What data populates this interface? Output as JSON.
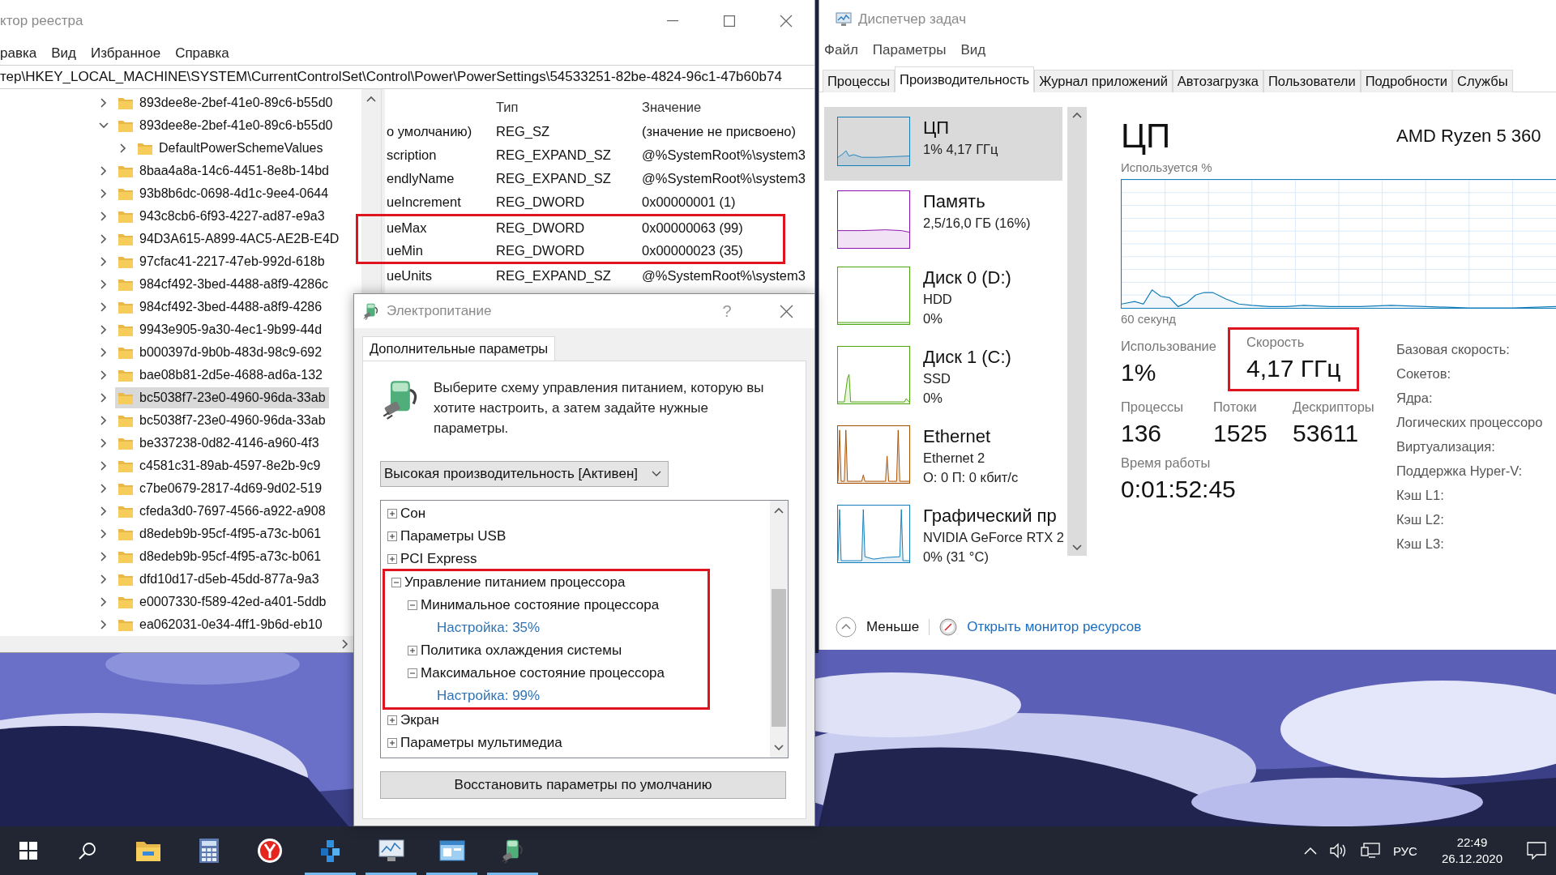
{
  "registry_editor": {
    "title": "ктор реестра",
    "menu": [
      "равка",
      "Вид",
      "Избранное",
      "Справка"
    ],
    "address": "тер\\HKEY_LOCAL_MACHINE\\SYSTEM\\CurrentControlSet\\Control\\Power\\PowerSettings\\54533251-82be-4824-96c1-47b60b74",
    "tree": [
      {
        "name": "893dee8e-2bef-41e0-89c6-b55d0",
        "expanded": false,
        "selected": false
      },
      {
        "name": "893dee8e-2bef-41e0-89c6-b55d0",
        "expanded": true,
        "selected": false,
        "children": [
          {
            "name": "DefaultPowerSchemeValues",
            "expanded": false,
            "selected": false
          }
        ]
      },
      {
        "name": "8baa4a8a-14c6-4451-8e8b-14bd",
        "expanded": false,
        "selected": false
      },
      {
        "name": "93b8b6dc-0698-4d1c-9ee4-0644",
        "expanded": false,
        "selected": false
      },
      {
        "name": "943c8cb6-6f93-4227-ad87-e9a3",
        "expanded": false,
        "selected": false
      },
      {
        "name": "94D3A615-A899-4AC5-AE2B-E4D",
        "expanded": false,
        "selected": false
      },
      {
        "name": "97cfac41-2217-47eb-992d-618b",
        "expanded": false,
        "selected": false
      },
      {
        "name": "984cf492-3bed-4488-a8f9-4286c",
        "expanded": false,
        "selected": false
      },
      {
        "name": "984cf492-3bed-4488-a8f9-4286",
        "expanded": false,
        "selected": false
      },
      {
        "name": "9943e905-9a30-4ec1-9b99-44d",
        "expanded": false,
        "selected": false
      },
      {
        "name": "b000397d-9b0b-483d-98c9-692",
        "expanded": false,
        "selected": false
      },
      {
        "name": "bae08b81-2d5e-4688-ad6a-132",
        "expanded": false,
        "selected": false
      },
      {
        "name": "bc5038f7-23e0-4960-96da-33ab",
        "expanded": false,
        "selected": true
      },
      {
        "name": "bc5038f7-23e0-4960-96da-33ab",
        "expanded": false,
        "selected": false
      },
      {
        "name": "be337238-0d82-4146-a960-4f3",
        "expanded": false,
        "selected": false
      },
      {
        "name": "c4581c31-89ab-4597-8e2b-9c9",
        "expanded": false,
        "selected": false
      },
      {
        "name": "c7be0679-2817-4d69-9d02-519",
        "expanded": false,
        "selected": false
      },
      {
        "name": "cfeda3d0-7697-4566-a922-a908",
        "expanded": false,
        "selected": false
      },
      {
        "name": "d8edeb9b-95cf-4f95-a73c-b061",
        "expanded": false,
        "selected": false
      },
      {
        "name": "d8edeb9b-95cf-4f95-a73c-b061",
        "expanded": false,
        "selected": false
      },
      {
        "name": "dfd10d17-d5eb-45dd-877a-9a3",
        "expanded": false,
        "selected": false
      },
      {
        "name": "e0007330-f589-42ed-a401-5ddb",
        "expanded": false,
        "selected": false
      },
      {
        "name": "ea062031-0e34-4ff1-9b6d-eb10",
        "expanded": false,
        "selected": false
      }
    ],
    "values": {
      "columns": [
        "Тип",
        "Значение"
      ],
      "rows": [
        {
          "name": "о умолчанию)",
          "type": "REG_SZ",
          "data": "(значение не присвоено)",
          "highlighted": false
        },
        {
          "name": "scription",
          "type": "REG_EXPAND_SZ",
          "data": "@%SystemRoot%\\system3",
          "highlighted": false
        },
        {
          "name": "endlyName",
          "type": "REG_EXPAND_SZ",
          "data": "@%SystemRoot%\\system3",
          "highlighted": false
        },
        {
          "name": "ueIncrement",
          "type": "REG_DWORD",
          "data": "0x00000001 (1)",
          "highlighted": false
        },
        {
          "name": "ueMax",
          "type": "REG_DWORD",
          "data": "0x00000063 (99)",
          "highlighted": true
        },
        {
          "name": "ueMin",
          "type": "REG_DWORD",
          "data": "0x00000023 (35)",
          "highlighted": true
        },
        {
          "name": "ueUnits",
          "type": "REG_EXPAND_SZ",
          "data": "@%SystemRoot%\\system3",
          "highlighted": false
        }
      ]
    }
  },
  "power_options": {
    "title": "Электропитание",
    "help": "?",
    "tab": "Дополнительные параметры",
    "description": "Выберите схему управления питанием, которую вы хотите настроить, а затем задайте нужные параметры.",
    "scheme": "Высокая производительность [Активен]",
    "settings": [
      {
        "kind": "group",
        "label": "Сон",
        "expanded": false,
        "highlighted": false
      },
      {
        "kind": "group",
        "label": "Параметры USB",
        "expanded": false,
        "highlighted": false
      },
      {
        "kind": "group",
        "label": "PCI Express",
        "expanded": false,
        "highlighted": false
      },
      {
        "kind": "group",
        "label": "Управление питанием процессора",
        "expanded": true,
        "highlighted": true,
        "children": [
          {
            "kind": "group",
            "label": "Минимальное состояние процессора",
            "expanded": true,
            "highlighted": false,
            "children": [
              {
                "kind": "value",
                "label": "Настройка: 35%"
              }
            ]
          },
          {
            "kind": "group",
            "label": "Политика охлаждения системы",
            "expanded": false,
            "highlighted": false
          },
          {
            "kind": "group",
            "label": "Максимальное состояние процессора",
            "expanded": true,
            "highlighted": false,
            "children": [
              {
                "kind": "value",
                "label": "Настройка: 99%"
              }
            ]
          }
        ]
      },
      {
        "kind": "group",
        "label": "Экран",
        "expanded": false,
        "highlighted": false
      },
      {
        "kind": "group",
        "label": "Параметры мультимедиа",
        "expanded": false,
        "highlighted": false
      }
    ],
    "restore_button": "Восстановить параметры по умолчанию"
  },
  "task_manager": {
    "title": "Диспетчер задач",
    "menu": [
      "Файл",
      "Параметры",
      "Вид"
    ],
    "tabs": [
      {
        "label": "Процессы",
        "selected": false
      },
      {
        "label": "Производительность",
        "selected": true
      },
      {
        "label": "Журнал приложений",
        "selected": false
      },
      {
        "label": "Автозагрузка",
        "selected": false
      },
      {
        "label": "Пользователи",
        "selected": false
      },
      {
        "label": "Подробности",
        "selected": false
      },
      {
        "label": "Службы",
        "selected": false
      }
    ],
    "resources": [
      {
        "kind": "cpu",
        "title": "ЦП",
        "lines": [
          "1%  4,17 ГГц"
        ],
        "color": "#117dbb",
        "selected": true
      },
      {
        "kind": "memory",
        "title": "Память",
        "lines": [
          "2,5/16,0 ГБ (16%)"
        ],
        "color": "#8b12ae",
        "selected": false
      },
      {
        "kind": "disk_idle",
        "title": "Диск 0 (D:)",
        "lines": [
          "HDD",
          "0%"
        ],
        "color": "#4da60c",
        "selected": false
      },
      {
        "kind": "disk_active",
        "title": "Диск 1 (C:)",
        "lines": [
          "SSD",
          "0%"
        ],
        "color": "#4da60c",
        "selected": false
      },
      {
        "kind": "network",
        "title": "Ethernet",
        "lines": [
          "Ethernet 2",
          "О: 0  П: 0 кбит/с"
        ],
        "color": "#a74f01",
        "selected": false
      },
      {
        "kind": "gpu",
        "title": "Графический пр",
        "lines": [
          "NVIDIA GeForce RTX 2",
          "0% (31 °C)"
        ],
        "color": "#117dbb",
        "selected": false
      }
    ],
    "detail": {
      "title": "ЦП",
      "model": "AMD Ryzen 5 360",
      "graph_label": "Используется %",
      "graph_time": "60 секунд",
      "stat_rows": [
        [
          {
            "label": "Использование",
            "value": "1%",
            "highlighted": false
          },
          {
            "label": "Скорость",
            "value": "4,17 ГГц",
            "highlighted": true
          }
        ],
        [
          {
            "label": "Процессы",
            "value": "136",
            "highlighted": false
          },
          {
            "label": "Потоки",
            "value": "1525",
            "highlighted": false
          },
          {
            "label": "Дескрипторы",
            "value": "53611",
            "highlighted": false
          }
        ],
        [
          {
            "label": "Время работы",
            "value": "0:01:52:45",
            "highlighted": false
          }
        ]
      ],
      "info_labels": [
        "Базовая скорость:",
        "Сокетов:",
        "Ядра:",
        "Логических процессоро",
        "Виртуализация:",
        "Поддержка Hyper-V:",
        "Кэш L1:",
        "Кэш L2:",
        "Кэш L3:"
      ]
    },
    "fewer_details": "Меньше",
    "resource_monitor_link": "Открыть монитор ресурсов"
  },
  "taskbar": {
    "apps": [
      {
        "kind": "explorer",
        "running": false
      },
      {
        "kind": "calculator",
        "running": false
      },
      {
        "kind": "browser",
        "running": false
      },
      {
        "kind": "registry",
        "running": true
      },
      {
        "kind": "monitor",
        "running": true
      },
      {
        "kind": "window",
        "running": true
      },
      {
        "kind": "power",
        "running": true
      }
    ],
    "language": "РУС",
    "time": "22:49",
    "date": "26.12.2020"
  }
}
